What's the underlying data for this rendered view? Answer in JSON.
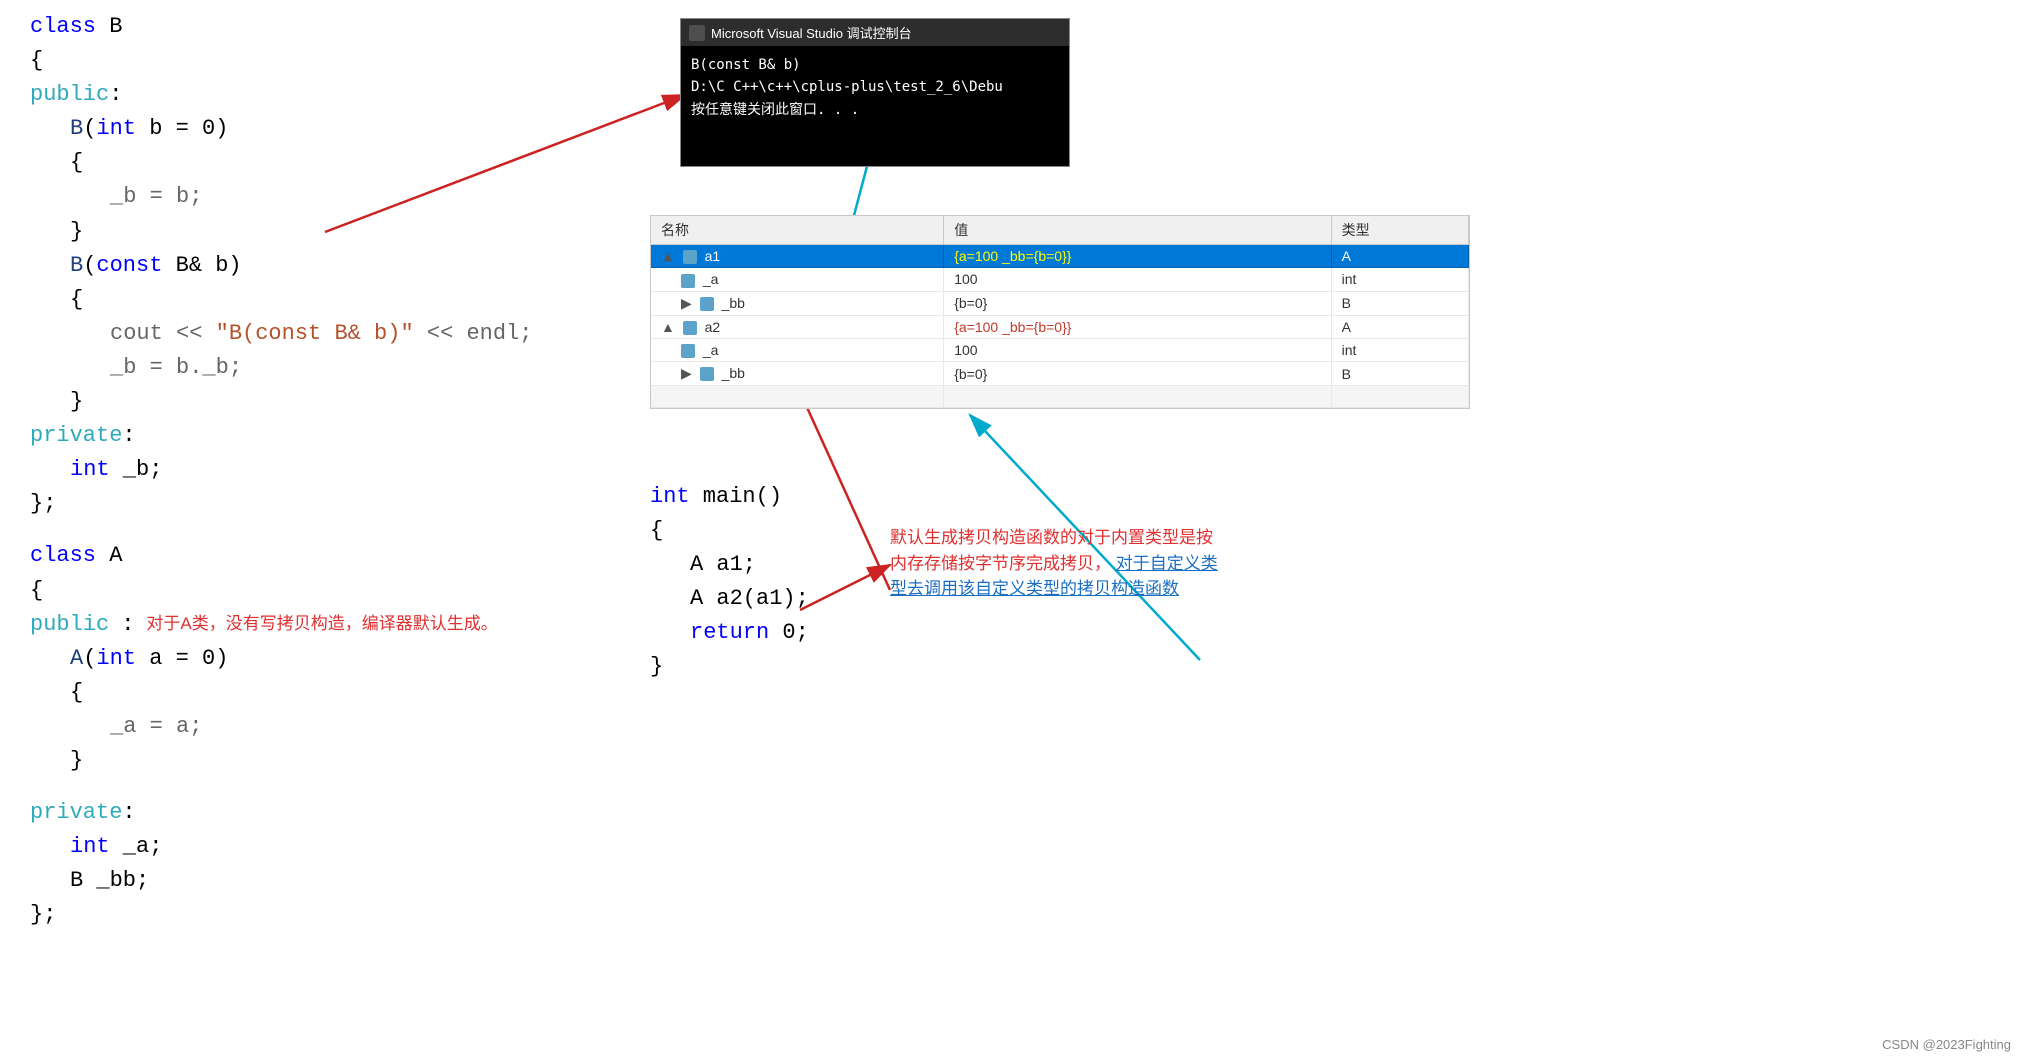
{
  "console": {
    "title": "Microsoft Visual Studio 调试控制台",
    "line1": "B(const B& b)",
    "line2": "D:\\C C++\\c++\\cplus-plus\\test_2_6\\Debu",
    "line3": "按任意键关闭此窗口. . ."
  },
  "code_left": {
    "lines": [
      {
        "text": "class B",
        "type": "class-decl"
      },
      {
        "text": "{",
        "type": "brace"
      },
      {
        "text": "public:",
        "type": "access"
      },
      {
        "text": "    B(int b = 0)",
        "type": "func"
      },
      {
        "text": "    {",
        "type": "brace"
      },
      {
        "text": "        _b = b;",
        "type": "body"
      },
      {
        "text": "    }",
        "type": "brace"
      },
      {
        "text": "    B(const B& b)",
        "type": "func"
      },
      {
        "text": "    {",
        "type": "brace"
      },
      {
        "text": "        cout << \"B(const B& b)\" << endl;",
        "type": "body"
      },
      {
        "text": "        _b = b._b;",
        "type": "body"
      },
      {
        "text": "    }",
        "type": "brace"
      },
      {
        "text": "private:",
        "type": "access"
      },
      {
        "text": "    int _b;",
        "type": "body"
      },
      {
        "text": "};",
        "type": "brace"
      },
      {
        "text": "",
        "type": "empty"
      },
      {
        "text": "class A",
        "type": "class-decl"
      },
      {
        "text": "{",
        "type": "brace"
      },
      {
        "text": "public:",
        "type": "access"
      },
      {
        "text": "    A(int a = 0)",
        "type": "func"
      },
      {
        "text": "    {",
        "type": "brace"
      },
      {
        "text": "        _a = a;",
        "type": "body"
      },
      {
        "text": "    }",
        "type": "brace"
      },
      {
        "text": "",
        "type": "empty"
      },
      {
        "text": "private:",
        "type": "access"
      },
      {
        "text": "    int _a;",
        "type": "body"
      },
      {
        "text": "    B _bb;",
        "type": "body"
      },
      {
        "text": "};",
        "type": "brace"
      }
    ]
  },
  "debug_table": {
    "headers": [
      "名称",
      "值",
      "类型"
    ],
    "rows": [
      {
        "name": "▲ a1",
        "value": "{a=100 _bb={b=0}}",
        "type": "A",
        "selected": true,
        "indent": 0,
        "has_icon": true
      },
      {
        "name": "_a",
        "value": "100",
        "type": "int",
        "selected": false,
        "indent": 1,
        "has_icon": true
      },
      {
        "name": "_bb",
        "value": "{b=0}",
        "type": "B",
        "selected": false,
        "indent": 1,
        "has_icon": true
      },
      {
        "name": "▲ a2",
        "value": "{a=100 _bb={b=0}}",
        "type": "A",
        "selected": false,
        "indent": 0,
        "has_icon": true,
        "val_highlight": true
      },
      {
        "name": "_a",
        "value": "100",
        "type": "int",
        "selected": false,
        "indent": 1,
        "has_icon": true
      },
      {
        "name": "_bb",
        "value": "{b=0}",
        "type": "B",
        "selected": false,
        "indent": 1,
        "has_icon": true
      }
    ]
  },
  "main_code": {
    "lines": [
      {
        "text": "int main()",
        "type": "func"
      },
      {
        "text": "{",
        "type": "brace"
      },
      {
        "text": "    A a1;",
        "type": "body"
      },
      {
        "text": "    A a2(a1);",
        "type": "body"
      },
      {
        "text": "    return 0;",
        "type": "body"
      },
      {
        "text": "}",
        "type": "brace"
      }
    ]
  },
  "annotation_class_a": {
    "text": "对于A类，没有写拷贝构造，编译器默认生成。"
  },
  "annotation_main": {
    "line1": "默认生成拷贝构造函数的对于内置类型是按",
    "line2": "内存存储按字节序完成拷贝，",
    "line3_blue": "对于自定义类",
    "line4_blue": "型去调用该自定义类型的拷贝构造函数"
  },
  "footer": {
    "text": "CSDN @2023Fighting"
  },
  "colors": {
    "keyword_blue": "#0000ff",
    "keyword_cyan": "#2eaabb",
    "text_red": "#c0392b",
    "text_blue_link": "#1a6fc4",
    "arrow_red": "#cc2222",
    "arrow_cyan": "#00aacc",
    "selected_bg": "#0078d7"
  }
}
